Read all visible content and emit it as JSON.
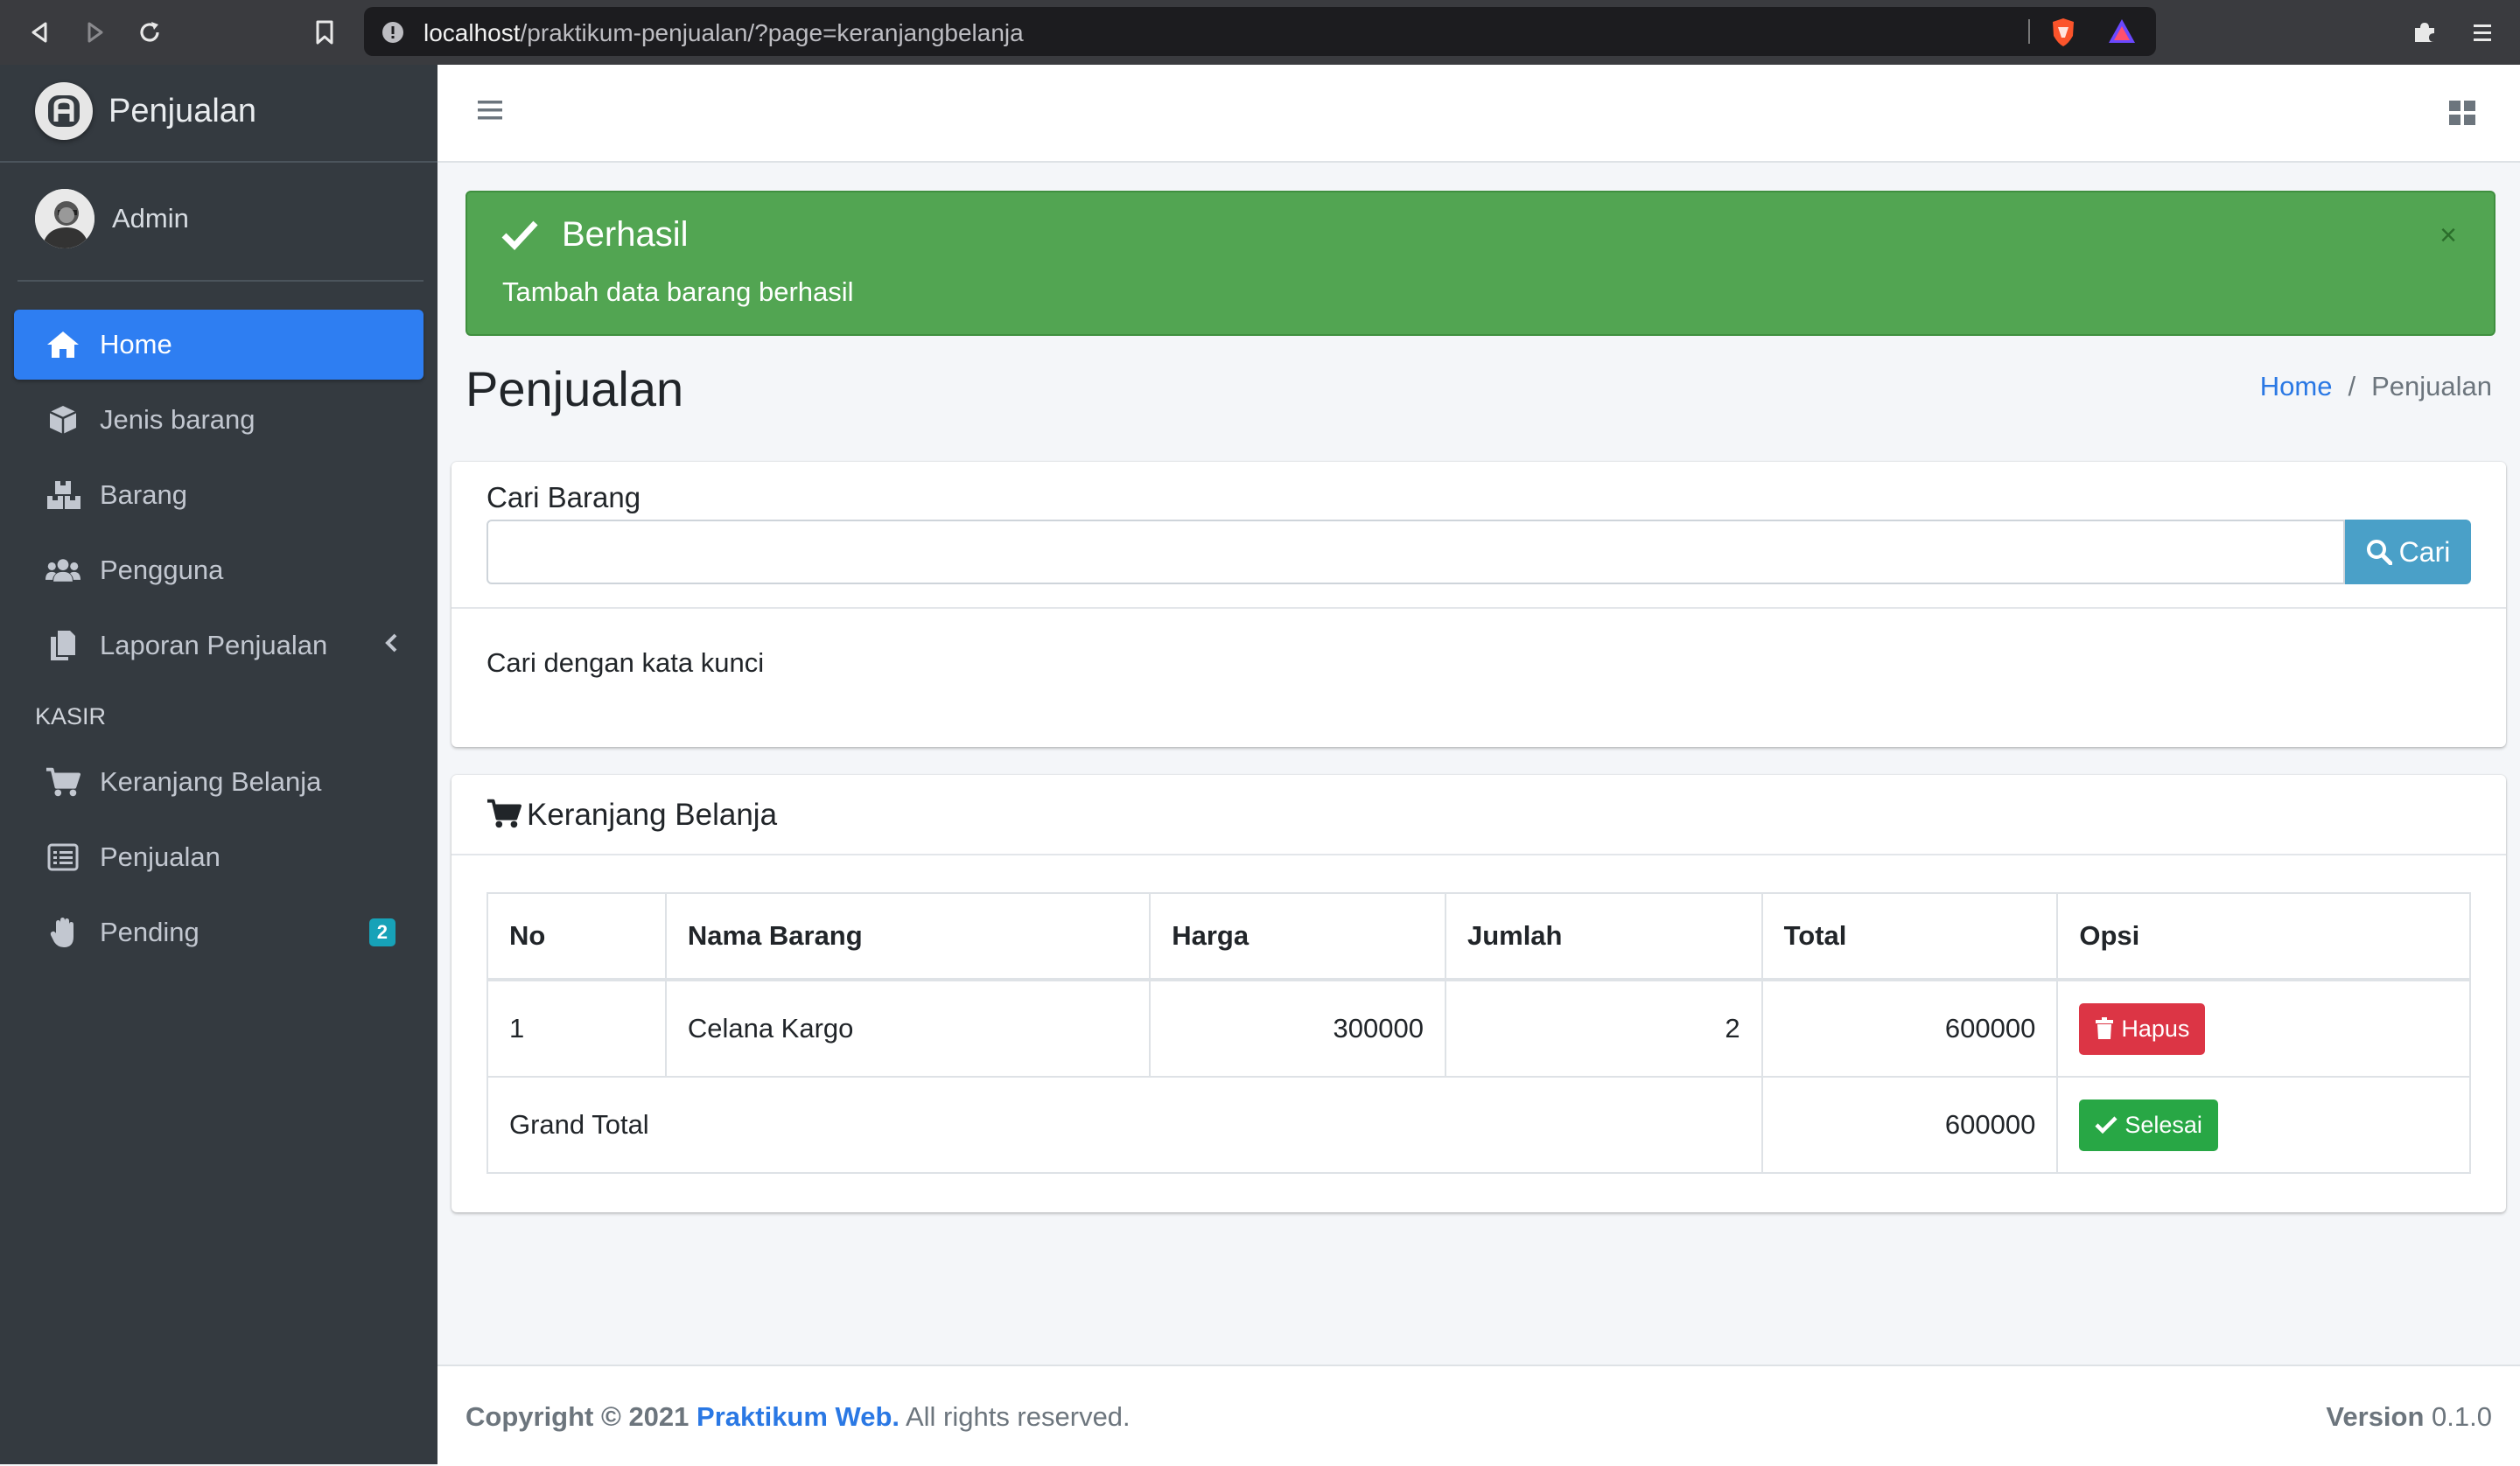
{
  "browser": {
    "url_host": "localhost",
    "url_path": "/praktikum-penjualan/?page=keranjangbelanja"
  },
  "sidebar": {
    "brand": "Penjualan",
    "user": "Admin",
    "items": [
      {
        "label": "Home",
        "icon": "home-icon",
        "active": true
      },
      {
        "label": "Jenis barang",
        "icon": "box-icon"
      },
      {
        "label": "Barang",
        "icon": "boxes-icon"
      },
      {
        "label": "Pengguna",
        "icon": "users-icon"
      },
      {
        "label": "Laporan Penjualan",
        "icon": "copy-icon",
        "has_submenu": true
      }
    ],
    "section_header": "KASIR",
    "kasir_items": [
      {
        "label": "Keranjang Belanja",
        "icon": "cart-icon"
      },
      {
        "label": "Penjualan",
        "icon": "list-icon"
      },
      {
        "label": "Pending",
        "icon": "hand-icon",
        "badge": "2"
      }
    ]
  },
  "alert": {
    "title": "Berhasil",
    "message": "Tambah data barang berhasil",
    "close": "×"
  },
  "page": {
    "title": "Penjualan",
    "breadcrumb": {
      "home": "Home",
      "sep": "/",
      "current": "Penjualan"
    }
  },
  "search": {
    "label": "Cari Barang",
    "value": "",
    "button": "Cari",
    "hint": "Cari dengan kata kunci"
  },
  "cart": {
    "title": "Keranjang Belanja",
    "columns": [
      "No",
      "Nama Barang",
      "Harga",
      "Jumlah",
      "Total",
      "Opsi"
    ],
    "rows": [
      {
        "no": "1",
        "nama": "Celana Kargo",
        "harga": "300000",
        "jumlah": "2",
        "total": "600000",
        "action": "Hapus"
      }
    ],
    "grand_total_label": "Grand Total",
    "grand_total": "600000",
    "finish_button": "Selesai"
  },
  "footer": {
    "copyright": "Copyright © 2021",
    "brand_link": "Praktikum Web.",
    "rights": "All rights reserved.",
    "version_label": "Version",
    "version": "0.1.0"
  },
  "colors": {
    "sidebar_bg": "#343a40",
    "active_blue": "#2e7ef2",
    "success_green": "#52a552",
    "danger_red": "#dc3545",
    "info_teal": "#4aa0c8"
  }
}
